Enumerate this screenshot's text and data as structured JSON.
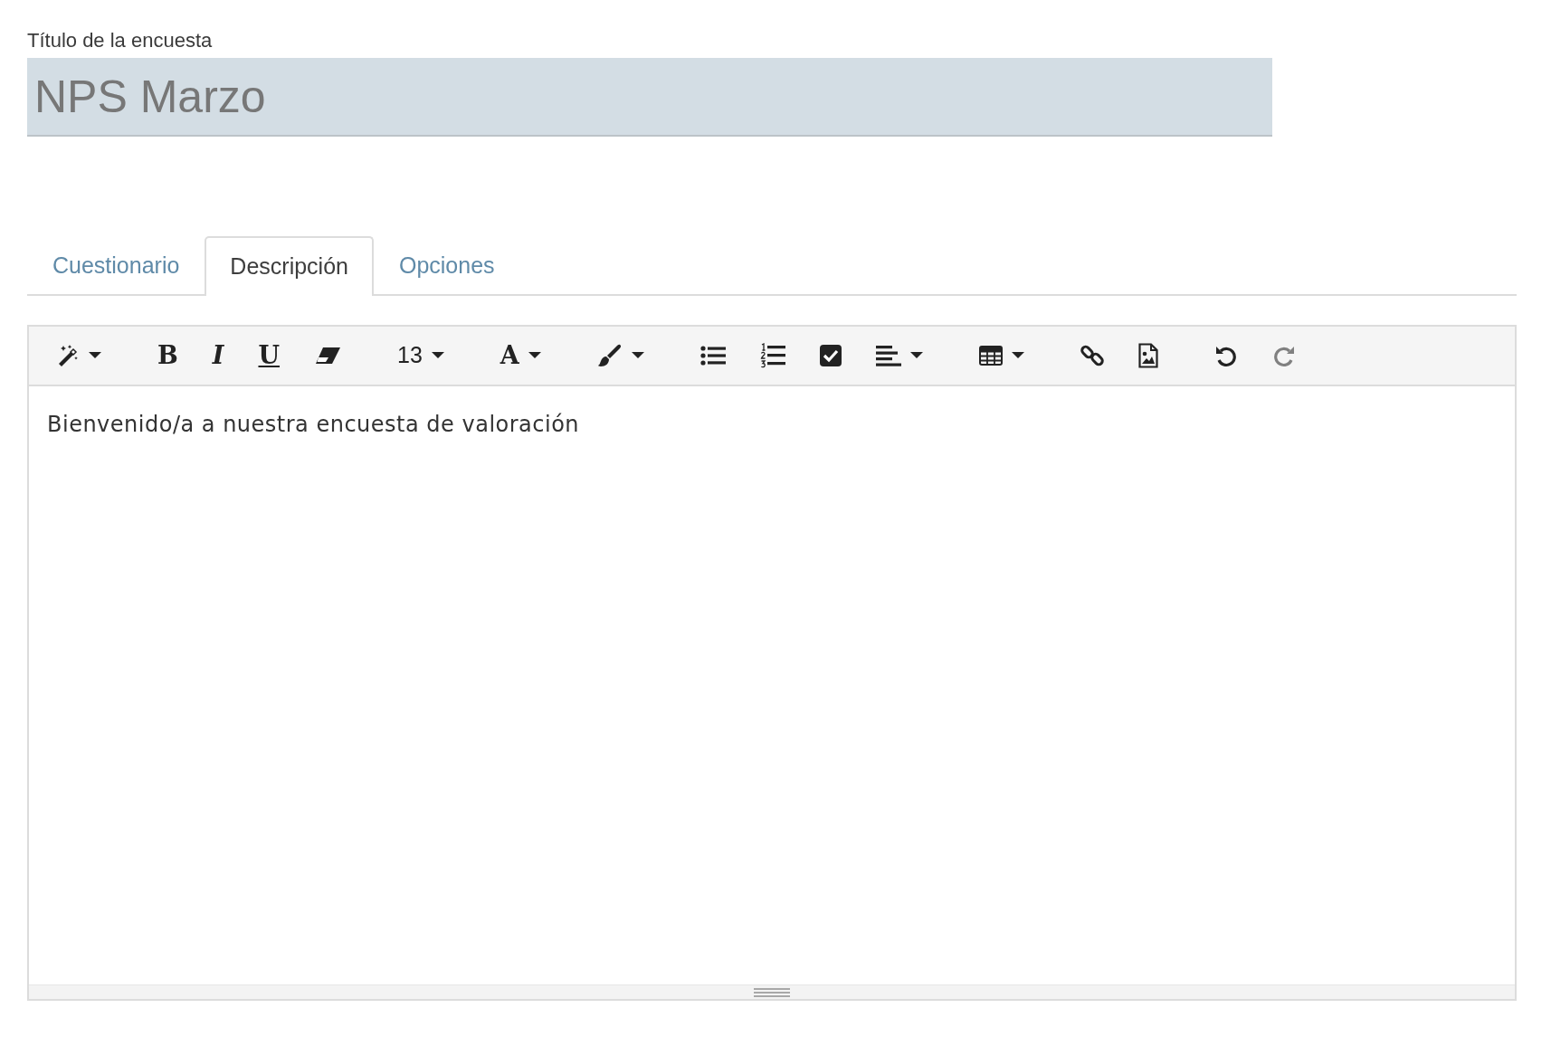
{
  "title_field": {
    "label": "Título de la encuesta",
    "value": "NPS Marzo"
  },
  "tabs": [
    {
      "label": "Cuestionario",
      "selected": false
    },
    {
      "label": "Descripción",
      "selected": true
    },
    {
      "label": "Opciones",
      "selected": false
    }
  ],
  "editor": {
    "toolbar": [
      [
        {
          "kind": "icon",
          "dropdown": true,
          "disabled": false
        }
      ],
      [
        {
          "kind": "glyph",
          "text": "B",
          "dropdown": false
        },
        {
          "kind": "glyph",
          "text": "I",
          "dropdown": false
        },
        {
          "kind": "glyph",
          "text": "U",
          "dropdown": false
        },
        {
          "kind": "icon",
          "dropdown": false,
          "disabled": false
        }
      ],
      [
        {
          "kind": "text",
          "text": "13",
          "dropdown": true
        }
      ],
      [
        {
          "kind": "glyph",
          "text": "A",
          "dropdown": true
        }
      ],
      [
        {
          "kind": "icon",
          "dropdown": true,
          "disabled": false
        }
      ],
      [
        {
          "kind": "icon",
          "dropdown": false,
          "disabled": false
        },
        {
          "kind": "icon",
          "dropdown": false,
          "disabled": false
        },
        {
          "kind": "icon",
          "dropdown": false,
          "disabled": false
        },
        {
          "kind": "icon",
          "dropdown": true,
          "disabled": false
        }
      ],
      [
        {
          "kind": "icon",
          "dropdown": true,
          "disabled": false
        }
      ],
      [
        {
          "kind": "icon",
          "dropdown": false,
          "disabled": false
        },
        {
          "kind": "icon",
          "dropdown": false,
          "disabled": false
        }
      ],
      [
        {
          "kind": "icon",
          "dropdown": false,
          "disabled": false
        },
        {
          "kind": "icon",
          "dropdown": false,
          "disabled": true
        }
      ]
    ],
    "content": "Bienvenido/a a nuestra encuesta de valoración"
  }
}
